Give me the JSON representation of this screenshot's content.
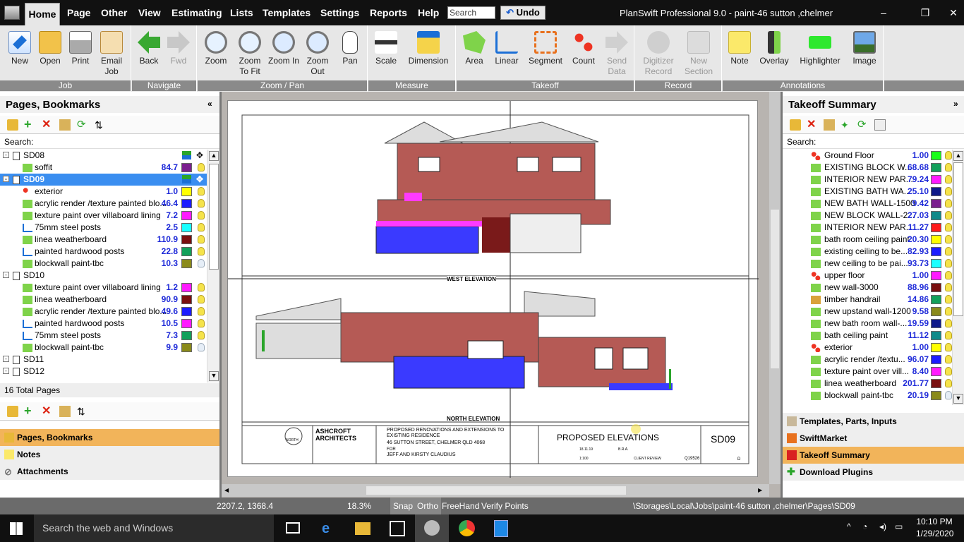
{
  "menu": {
    "items": [
      "Home",
      "Page",
      "Other",
      "View",
      "Estimating",
      "Lists",
      "Templates",
      "Settings",
      "Reports",
      "Help"
    ],
    "search_placeholder": "Search",
    "undo": "Undo",
    "title": "PlanSwift Professional 9.0 - paint-46 sutton ,chelmer"
  },
  "ribbon": {
    "groups": [
      {
        "label": "Job",
        "buttons": [
          "New",
          "Open",
          "Print",
          "Email Job"
        ]
      },
      {
        "label": "Navigate",
        "buttons": [
          "Back",
          "Fwd"
        ]
      },
      {
        "label": "Zoom / Pan",
        "buttons": [
          "Zoom",
          "Zoom To Fit",
          "Zoom In",
          "Zoom Out",
          "Pan"
        ]
      },
      {
        "label": "Measure",
        "buttons": [
          "Scale",
          "Dimension"
        ]
      },
      {
        "label": "Takeoff",
        "buttons": [
          "Area",
          "Linear",
          "Segment",
          "Count",
          "Send Data"
        ]
      },
      {
        "label": "Record",
        "buttons": [
          "Digitizer Record",
          "New Section"
        ]
      },
      {
        "label": "Annotations",
        "buttons": [
          "Note",
          "Overlay",
          "Highlighter",
          "Image"
        ]
      }
    ]
  },
  "pages": {
    "title": "Pages, Bookmarks",
    "search_label": "Search:",
    "total": "16 Total Pages",
    "rows": [
      {
        "label": "SD08",
        "value": "",
        "color": ""
      },
      {
        "label": "soffit",
        "value": "84.7",
        "color": "#7b1f8f"
      },
      {
        "label": "SD09",
        "value": "",
        "color": ""
      },
      {
        "label": "exterior",
        "value": "1.0",
        "color": "#ffff00"
      },
      {
        "label": "acrylic render /texture painted blo...",
        "value": "46.4",
        "color": "#1c1cff"
      },
      {
        "label": "texture paint over villaboard lining",
        "value": "7.2",
        "color": "#ff1aff"
      },
      {
        "label": "75mm steel posts",
        "value": "2.5",
        "color": "#1affff"
      },
      {
        "label": "linea weatherboard",
        "value": "110.9",
        "color": "#7a0f0f"
      },
      {
        "label": "painted hardwood posts",
        "value": "22.8",
        "color": "#12a05a"
      },
      {
        "label": "blockwall paint-tbc",
        "value": "10.3",
        "color": "#8a8a1a"
      },
      {
        "label": "SD10",
        "value": "",
        "color": ""
      },
      {
        "label": "texture paint over villaboard lining",
        "value": "1.2",
        "color": "#ff1aff"
      },
      {
        "label": "linea weatherboard",
        "value": "90.9",
        "color": "#7a0f0f"
      },
      {
        "label": "acrylic render /texture painted blo...",
        "value": "49.6",
        "color": "#1c1cff"
      },
      {
        "label": "painted hardwood posts",
        "value": "10.5",
        "color": "#ff1aff"
      },
      {
        "label": "75mm steel posts",
        "value": "7.3",
        "color": "#12a05a"
      },
      {
        "label": "blockwall paint-tbc",
        "value": "9.9",
        "color": "#8a8a1a"
      },
      {
        "label": "SD11",
        "value": "",
        "color": ""
      },
      {
        "label": "SD12",
        "value": "",
        "color": ""
      }
    ]
  },
  "accordion_left": [
    "Pages, Bookmarks",
    "Notes",
    "Attachments"
  ],
  "takeoff": {
    "title": "Takeoff Summary",
    "search_label": "Search:",
    "rows": [
      {
        "label": "Ground Floor",
        "value": "1.00",
        "color": "#1aff1a"
      },
      {
        "label": "EXISTING BLOCK W...",
        "value": "68.68",
        "color": "#12a05a"
      },
      {
        "label": "INTERIOR NEW PAR...",
        "value": "79.24",
        "color": "#ff1aff"
      },
      {
        "label": "EXISTING BATH WA...",
        "value": "25.10",
        "color": "#0f1a8a"
      },
      {
        "label": "NEW BATH WALL-1500",
        "value": "9.42",
        "color": "#7b1f8f"
      },
      {
        "label": "NEW BLOCK WALL-2...",
        "value": "27.03",
        "color": "#0f8a8a"
      },
      {
        "label": "INTERIOR NEW PAR...",
        "value": "11.27",
        "color": "#ff1a1a"
      },
      {
        "label": "bath room ceiling paint",
        "value": "20.30",
        "color": "#ffff00"
      },
      {
        "label": "existing ceiling to be...",
        "value": "82.93",
        "color": "#1c1cff"
      },
      {
        "label": "new ceiling to be pai...",
        "value": "93.73",
        "color": "#1affff"
      },
      {
        "label": "upper floor",
        "value": "1.00",
        "color": "#ff1aff"
      },
      {
        "label": "new wall-3000",
        "value": "88.96",
        "color": "#7a0f0f"
      },
      {
        "label": "timber handrail",
        "value": "14.86",
        "color": "#12a05a"
      },
      {
        "label": "new upstand wall-1200",
        "value": "9.58",
        "color": "#8a8a1a"
      },
      {
        "label": "new bath room wall-...",
        "value": "19.59",
        "color": "#0f1a8a"
      },
      {
        "label": "bath ceiling paint",
        "value": "11.12",
        "color": "#0f8a8a"
      },
      {
        "label": "exterior",
        "value": "1.00",
        "color": "#ffff00"
      },
      {
        "label": "acrylic render /textu...",
        "value": "96.07",
        "color": "#1c1cff"
      },
      {
        "label": "texture paint over vill...",
        "value": "8.40",
        "color": "#ff1aff"
      },
      {
        "label": "linea weatherboard",
        "value": "201.77",
        "color": "#7a0f0f"
      },
      {
        "label": "blockwall paint-tbc",
        "value": "20.19",
        "color": "#8a8a1a"
      }
    ]
  },
  "accordion_right": [
    "Templates, Parts, Inputs",
    "SwiftMarket",
    "Takeoff Summary",
    "Download Plugins"
  ],
  "drawing": {
    "west_label": "WEST ELEVATION",
    "north_label": "NORTH ELEVATION",
    "title": "PROPOSED ELEVATIONS",
    "sheet": "SD09",
    "project": "PROPOSED RENOVATIONS AND EXTENSIONS TO EXISTING RESIDENCE",
    "address": "46 SUTTON STREET, CHELMER QLD 4068",
    "for_label": "FOR",
    "client": "JEFF AND KIRSTY CLAUDIUS",
    "firm": "ASHCROFT ARCHITECTS",
    "north": "NORTH",
    "date": "18.11.19",
    "scale": "1:100",
    "issue": "CLIENT REVIEW",
    "drawn": "B.R.A.",
    "project_no": "Q19526",
    "revision": "D"
  },
  "status": {
    "coords": "2207.2, 1368.4",
    "zoom": "18.3%",
    "snap": "Snap",
    "ortho": "Ortho",
    "freehand": "FreeHand",
    "verify": "Verify Points",
    "path": "\\Storages\\Local\\Jobs\\paint-46 sutton ,chelmer\\Pages\\SD09"
  },
  "taskbar": {
    "search": "Search the web and Windows",
    "time": "10:10 PM",
    "date": "1/29/2020"
  }
}
